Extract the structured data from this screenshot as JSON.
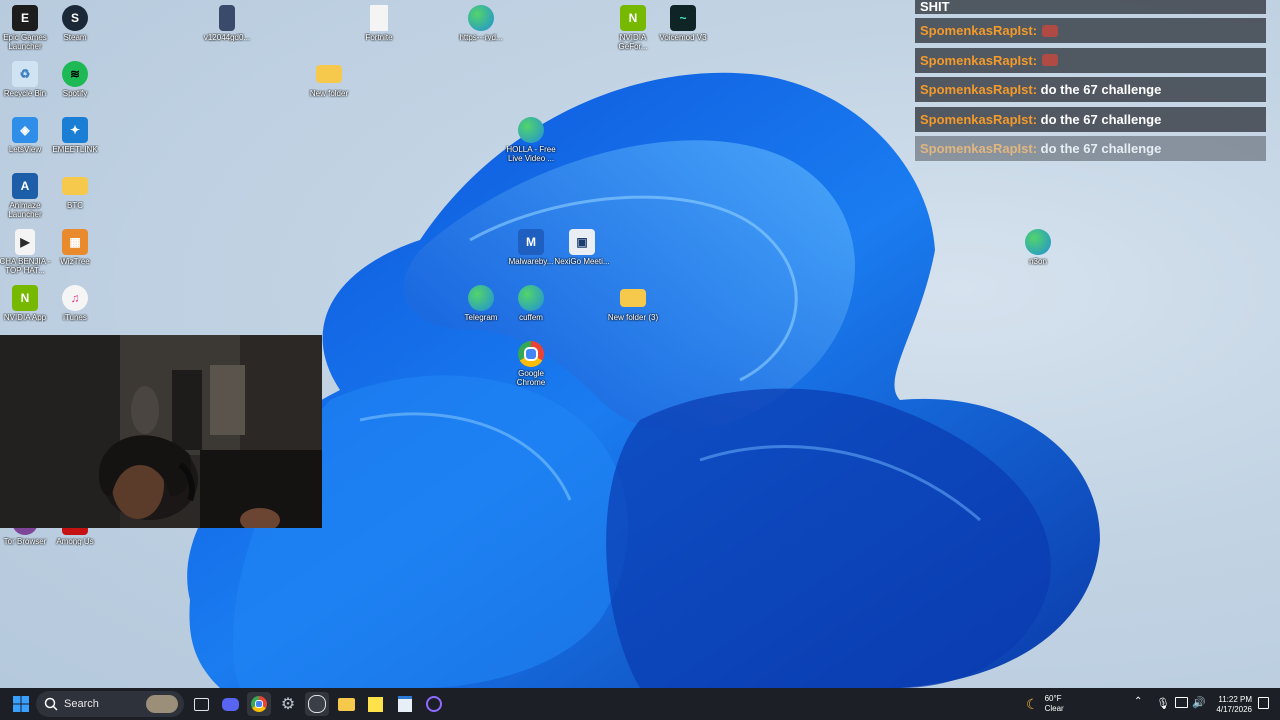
{
  "desktop": {
    "icons": [
      {
        "label": "Epic Games Launcher",
        "icon": "epic-games-icon",
        "color": "#1d1d1d"
      },
      {
        "label": "Steam",
        "icon": "steam-icon",
        "color": "#1b2838"
      },
      {
        "label": "v12044gd0...",
        "icon": "file-icon",
        "color": "#3a4a6a"
      },
      {
        "label": "Fortnite",
        "icon": "document-icon",
        "color": "#f4f4f4"
      },
      {
        "label": "https---ryd...",
        "icon": "edge-icon",
        "color": "#1e8fd8"
      },
      {
        "label": "NVIDIA GeFor...",
        "icon": "nvidia-icon",
        "color": "#76b900"
      },
      {
        "label": "Voicemod V3",
        "icon": "voicemod-icon",
        "color": "#0f2424"
      },
      {
        "label": "Recycle Bin",
        "icon": "recycle-bin-icon",
        "color": "#cfe3f3"
      },
      {
        "label": "Spotify",
        "icon": "spotify-icon",
        "color": "#1db954"
      },
      {
        "label": "New folder",
        "icon": "folder-icon",
        "color": "#f6c94c"
      },
      {
        "label": "LetsView",
        "icon": "letsview-icon",
        "color": "#2f8fe8"
      },
      {
        "label": "EMEETLINK",
        "icon": "emeetlink-icon",
        "color": "#1a7fd4"
      },
      {
        "label": "HOLLA - Free Live Video ...",
        "icon": "edge-icon",
        "color": "#1e8fd8"
      },
      {
        "label": "Animaze Launcher",
        "icon": "animaze-icon",
        "color": "#1c5ea8"
      },
      {
        "label": "BTC",
        "icon": "folder-icon",
        "color": "#f6c94c"
      },
      {
        "label": "CHA BENJIA - TOP HAT...",
        "icon": "video-icon",
        "color": "#2b2b2b"
      },
      {
        "label": "WizTree",
        "icon": "wiztree-icon",
        "color": "#e98b2c"
      },
      {
        "label": "Malwareby...",
        "icon": "malwarebytes-icon",
        "color": "#1f5fbf"
      },
      {
        "label": "NexiGo Meeti...",
        "icon": "nexigo-icon",
        "color": "#e9eef5"
      },
      {
        "label": "n3on",
        "icon": "edge-icon",
        "color": "#1e8fd8"
      },
      {
        "label": "NVIDIA App",
        "icon": "nvidia-icon",
        "color": "#76b900"
      },
      {
        "label": "iTunes",
        "icon": "itunes-icon",
        "color": "#f5f5f5"
      },
      {
        "label": "Telegram",
        "icon": "edge-icon",
        "color": "#1e8fd8"
      },
      {
        "label": "cuffem",
        "icon": "edge-icon",
        "color": "#1e8fd8"
      },
      {
        "label": "New folder (3)",
        "icon": "folder-icon",
        "color": "#f6c94c"
      },
      {
        "label": "Google Chrome",
        "icon": "chrome-icon",
        "color": "#ffffff"
      },
      {
        "label": "Tor Browser",
        "icon": "tor-browser-icon",
        "color": "#7d4698"
      },
      {
        "label": "Among Us",
        "icon": "among-us-icon",
        "color": "#c51111"
      }
    ]
  },
  "chat": {
    "partial": "SHIT",
    "messages": [
      {
        "user": "SpomenkasRapIst",
        "text": "",
        "emote": true
      },
      {
        "user": "SpomenkasRapIst",
        "text": "",
        "emote": true
      },
      {
        "user": "SpomenkasRapIst",
        "text": "do the 67 challenge",
        "emote": false
      },
      {
        "user": "SpomenkasRapIst",
        "text": "do the 67 challenge",
        "emote": false
      },
      {
        "user": "SpomenkasRapIst",
        "text": "do the 67 challenge",
        "emote": false
      }
    ],
    "separator": ":"
  },
  "taskbar": {
    "search_label": "Search",
    "apps": [
      "file-explorer-icon",
      "discord-icon",
      "chrome-icon",
      "settings-icon",
      "obs-icon",
      "folder-icon",
      "sticky-notes-icon",
      "notepad-icon",
      "cortana-icon"
    ]
  },
  "tray": {
    "temperature": "60°F",
    "weather": "Clear",
    "time": "11:22 PM",
    "date": "4/17/2026"
  }
}
